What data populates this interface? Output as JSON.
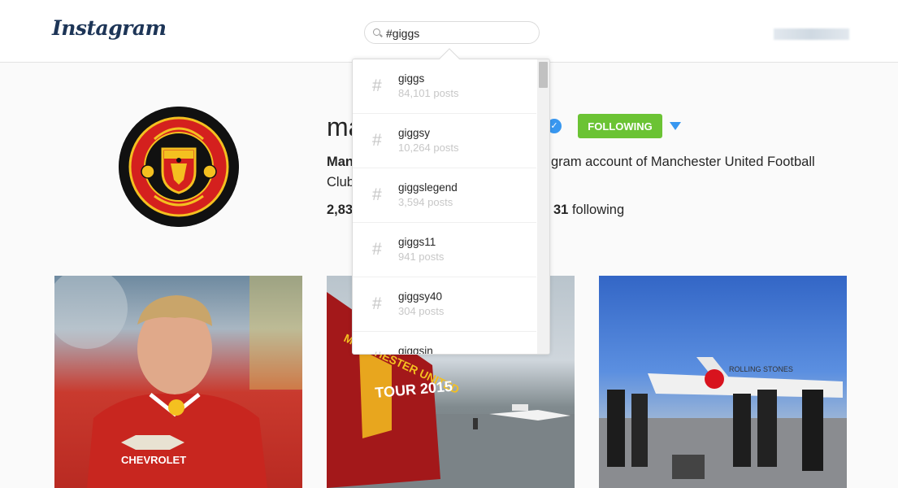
{
  "header": {
    "logo": "Instagram",
    "search_value": "#giggs"
  },
  "profile": {
    "username": "ma",
    "follow_label": "FOLLOWING",
    "bio_name": "Man",
    "bio_line1_rest": "gram account of Manchester United Football",
    "bio_line2": "Club",
    "stats_left": "2,83",
    "following_count": "31",
    "following_label": "following"
  },
  "search_results": [
    {
      "tag": "giggs",
      "count": "84,101 posts"
    },
    {
      "tag": "giggsy",
      "count": "10,264 posts"
    },
    {
      "tag": "giggslegend",
      "count": "3,594 posts"
    },
    {
      "tag": "giggs11",
      "count": "941 posts"
    },
    {
      "tag": "giggsy40",
      "count": "304 posts"
    },
    {
      "tag": "giggsin",
      "count": ""
    }
  ],
  "posts": [
    {
      "chevrolet_text": "CHEVROLET"
    },
    {
      "bus_text": "TOUR 2015",
      "crest_text": "MANCHESTER UNITED"
    },
    {
      "plane_text": "ROLLING STONES"
    }
  ],
  "colors": {
    "follow": "#6bc334",
    "verified": "#3897f0",
    "crest_red": "#d4201e",
    "crest_yellow": "#f4c020"
  }
}
